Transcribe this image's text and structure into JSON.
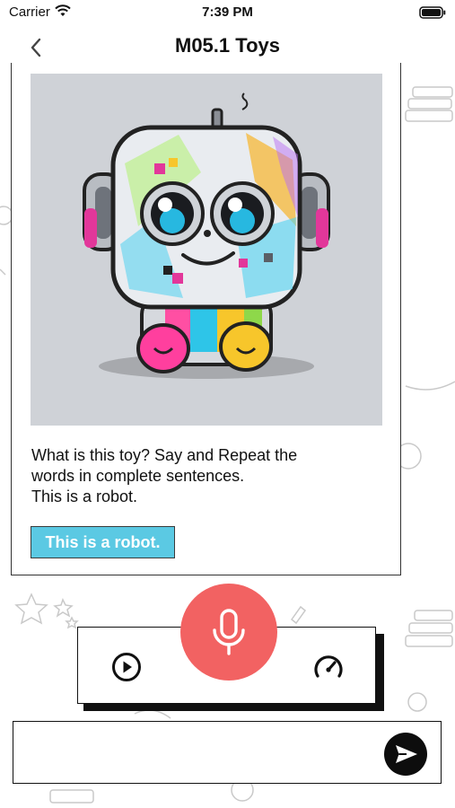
{
  "status_bar": {
    "carrier": "Carrier",
    "time": "7:39 PM"
  },
  "nav": {
    "title": "M05.1 Toys",
    "back_icon": "chevron-left-icon"
  },
  "card": {
    "image_subject": "robot toy illustration",
    "question_line1": "What is this toy?  Say and Repeat the",
    "question_line2": "words in complete sentences.",
    "question_line3": "This is a robot.",
    "answer_chip": "This is a robot."
  },
  "controls": {
    "play_icon": "play-icon",
    "mic_icon": "microphone-icon",
    "speed_icon": "speedometer-icon"
  },
  "input": {
    "value": "",
    "placeholder": "",
    "send_icon": "send-icon"
  },
  "colors": {
    "mic_button": "#f26262",
    "answer_chip": "#5bc9e3",
    "image_background": "#cfd2d7",
    "send_button": "#0d0d0d"
  }
}
